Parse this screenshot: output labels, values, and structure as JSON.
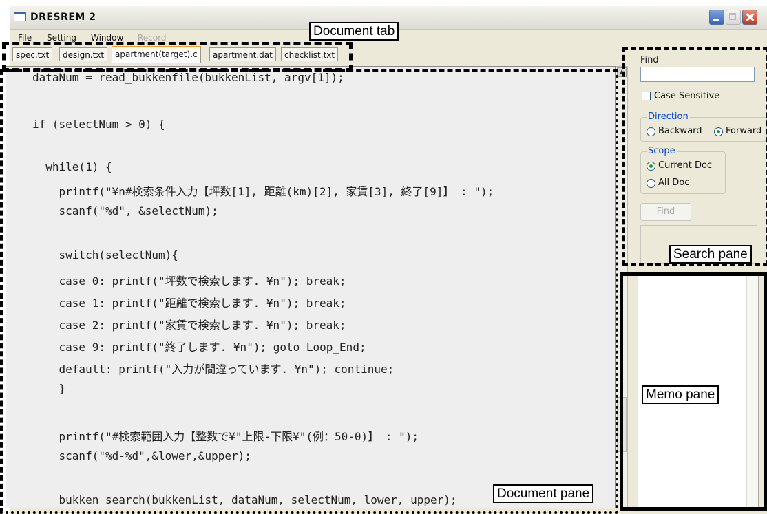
{
  "window": {
    "title": "DRESREM 2"
  },
  "menu": [
    {
      "label": "File",
      "enabled": true
    },
    {
      "label": "Setting",
      "enabled": true
    },
    {
      "label": "Window",
      "enabled": true
    },
    {
      "label": "Record",
      "enabled": false
    }
  ],
  "tabs": [
    {
      "label": "spec.txt",
      "active": false
    },
    {
      "label": "design.txt",
      "active": false
    },
    {
      "label": "apartment(target).c",
      "active": true
    },
    {
      "label": "apartment.dat",
      "active": false
    },
    {
      "label": "checklist.txt",
      "active": false
    }
  ],
  "code_lines": [
    "dataNum = read_bukkenfile(bukkenList, argv[1]);",
    "",
    "if (selectNum > 0) {",
    "",
    "  while(1) {",
    "    printf(\"¥n#検索条件入力【坪数[1], 距離(km)[2], 家賃[3], 終了[9]】 : \");",
    "    scanf(\"%d\", &selectNum);",
    "",
    "    switch(selectNum){",
    "    case 0: printf(\"坪数で検索します. ¥n\"); break;",
    "    case 1: printf(\"距離で検索します. ¥n\"); break;",
    "    case 2: printf(\"家賃で検索します. ¥n\"); break;",
    "    case 9: printf(\"終了します. ¥n\"); goto Loop_End;",
    "    default: printf(\"入力が間違っています. ¥n\"); continue;",
    "    }",
    "",
    "    printf(\"#検索範囲入力【整数で¥\"上限-下限¥\"(例：50-0)】 : \");",
    "    scanf(\"%d-%d\",&lower,&upper);",
    "",
    "    bukken_search(bukkenList, dataNum, selectNum, lower, upper);"
  ],
  "search": {
    "find_label": "Find",
    "find_value": "",
    "case_sensitive_label": "Case Sensitive",
    "case_sensitive_checked": false,
    "direction_title": "Direction",
    "direction_backward": "Backward",
    "direction_forward": "Forward",
    "direction_selected": "Forward",
    "scope_title": "Scope",
    "scope_current": "Current Doc",
    "scope_all": "All Doc",
    "scope_selected": "Current Doc",
    "find_button": "Find"
  },
  "annotations": {
    "document_tab": "Document tab",
    "search_pane": "Search pane",
    "memo_pane": "Memo pane",
    "document_pane": "Document pane"
  }
}
